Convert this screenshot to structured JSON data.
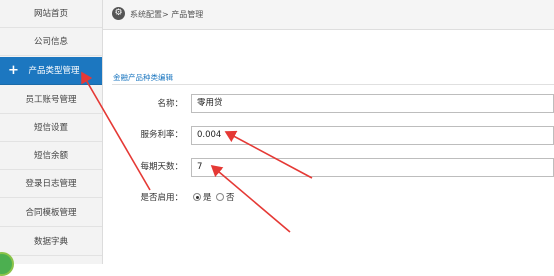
{
  "sidebar": {
    "items": [
      {
        "label": "网站首页"
      },
      {
        "label": "公司信息"
      },
      {
        "label": "产品类型管理",
        "active": true,
        "icon": "plus-icon"
      },
      {
        "label": "员工账号管理"
      },
      {
        "label": "短信设置"
      },
      {
        "label": "短信余额"
      },
      {
        "label": "登录日志管理"
      },
      {
        "label": "合同模板管理"
      },
      {
        "label": "数据字典"
      }
    ]
  },
  "header": {
    "icon": "settings-circle-icon",
    "breadcrumb": "系统配置> 产品管理"
  },
  "form": {
    "section_title": "金融产品种类编辑",
    "name_label": "名称：",
    "name_value": "零用贷",
    "rate_label": "服务利率：",
    "rate_value": "0.004",
    "days_label": "每期天数：",
    "days_value": "7",
    "enabled_label": "是否启用：",
    "enabled_yes": "是",
    "enabled_no": "否",
    "enabled_selected": "是"
  },
  "colors": {
    "accent": "#1c77c0",
    "annotation_arrow": "#e53935"
  }
}
